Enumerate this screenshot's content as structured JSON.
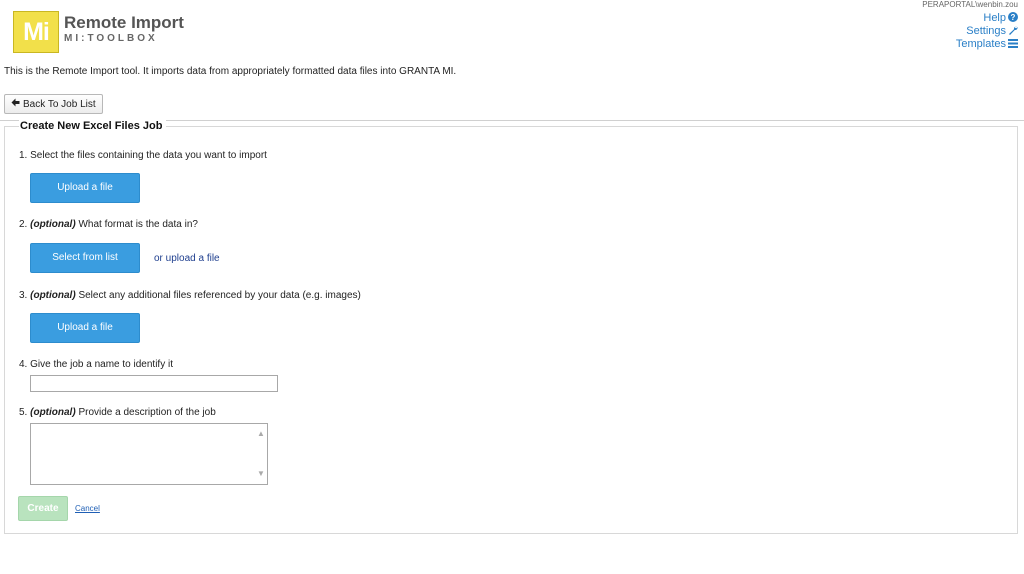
{
  "header": {
    "logo_text": "Mi",
    "title": "Remote Import",
    "subtitle": "MI:TOOLBOX",
    "user": "PERAPORTAL\\wenbin.zou",
    "links": {
      "help": "Help",
      "settings": "Settings",
      "templates": "Templates"
    }
  },
  "intro_text": "This is the Remote Import tool. It imports data from appropriately formatted data files into GRANTA MI.",
  "back_button_label": "Back To Job List",
  "form": {
    "title": "Create New Excel Files Job",
    "step1": {
      "text": "1. Select the files containing the data you want to import",
      "button": "Upload a file"
    },
    "step2": {
      "number": "2.",
      "optional": "(optional)",
      "text": "What format is the data in?",
      "button": "Select from list",
      "alt_link": "or upload a file"
    },
    "step3": {
      "number": "3.",
      "optional": "(optional)",
      "text": "Select any additional files referenced by your data (e.g. images)",
      "button": "Upload a file"
    },
    "step4": {
      "text": "4. Give the job a name to identify it",
      "value": ""
    },
    "step5": {
      "number": "5.",
      "optional": "(optional)",
      "text": "Provide a description of the job",
      "value": ""
    },
    "create_label": "Create",
    "cancel_label": "Cancel"
  },
  "colors": {
    "primary_button": "#3a9de0",
    "create_disabled": "#b9e3be",
    "link": "#2a7fc7",
    "logo_yellow": "#f2e04a"
  }
}
